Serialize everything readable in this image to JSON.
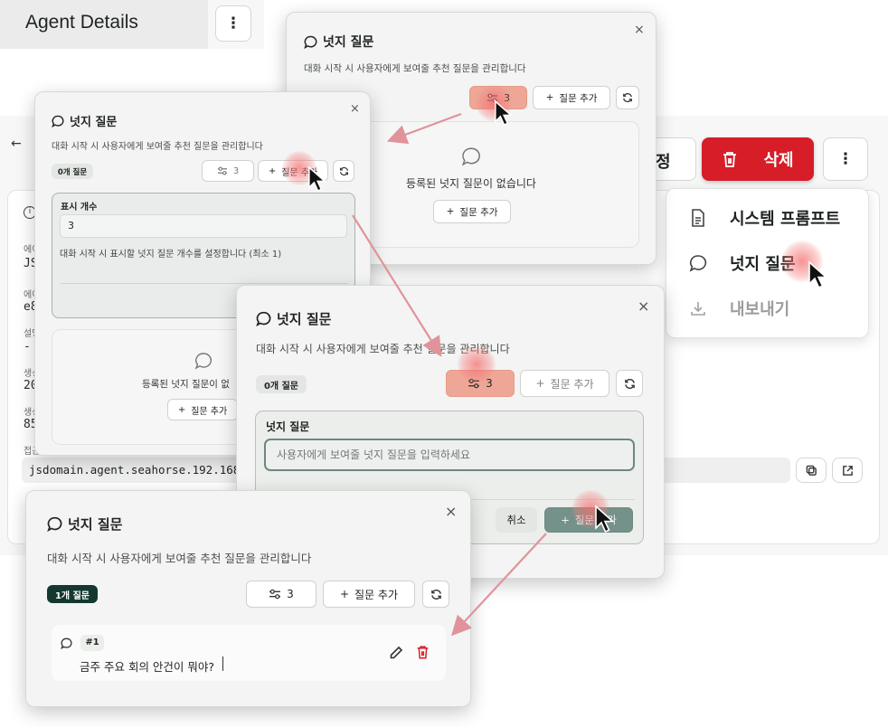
{
  "page": {
    "title": "Agent Details",
    "url_value": "jsdomain.agent.seahorse.192.168.11",
    "info_labels": [
      "에이",
      "에이",
      "설명",
      "생성",
      "생성",
      "접근"
    ],
    "info_values": [
      "JS",
      "e8",
      "-",
      "20",
      "85"
    ],
    "edit_label_partial": "정",
    "delete_label": "삭제",
    "back_arrow": "←"
  },
  "menu": {
    "items": [
      {
        "label": "시스템 프롬프트",
        "icon": "document-icon"
      },
      {
        "label": "넛지 질문",
        "icon": "chat-bubble-icon"
      },
      {
        "label": "내보내기",
        "icon": "download-icon"
      }
    ]
  },
  "modal_common": {
    "title": "넛지 질문",
    "description": "대화 시작 시 사용자에게 보여줄 추천 질문을 관리합니다",
    "description_alt": "대화 시작 시 사용자에게 보여줄 추천 질문을 관리합니다",
    "display_count_value": "3",
    "add_question_label": "질문 추가",
    "empty_label": "등록된 넛지 질문이 없습니다"
  },
  "modal_top": {
    "description": "대화 시작 시 사용자에게 보여줄 추천 질문을 관리합니다",
    "count": "3",
    "add_label": "질문 추가",
    "empty_text": "등록된 넛지 질문이 없습니다",
    "empty_add_label": "질문 추가"
  },
  "modal_left": {
    "description": "대화 시작 시 사용자에게 보여줄 추천 질문을 관리합니다",
    "badge": "0개 질문",
    "count": "3",
    "add_label": "질문 추가",
    "setting_label": "표시 개수",
    "setting_value": "3",
    "setting_help": "대화 시작 시 표시할 넛지 질문 개수를 설정합니다 (최소 1)",
    "empty_text": "등록된 넛지 질문이 없",
    "empty_add_label": "질문 추가"
  },
  "modal_center": {
    "description": "대화 시작 시 사용자에게 보여줄 추천 질문을 관리합니다",
    "badge": "0개 질문",
    "count": "3",
    "add_label": "질문 추가",
    "form_label": "넛지 질문",
    "input_placeholder": "사용자에게 보여줄 넛지 질문을 입력하세요",
    "cancel_label": "취소",
    "submit_label": "질문 추가"
  },
  "modal_bottom": {
    "description": "대화 시작 시 사용자에게 보여줄 추천 질문을 관리합니다",
    "badge": "1개 질문",
    "count": "3",
    "add_label": "질문 추가",
    "question_index": "#1",
    "question_text": "금주 주요 회의 안건이 뭐야?"
  },
  "colors": {
    "delete_red": "#d61d28",
    "badge_dark": "#14382f",
    "count_active": "#eea796",
    "submit_green": "#74928a",
    "arrow_pink": "#e0939b"
  }
}
